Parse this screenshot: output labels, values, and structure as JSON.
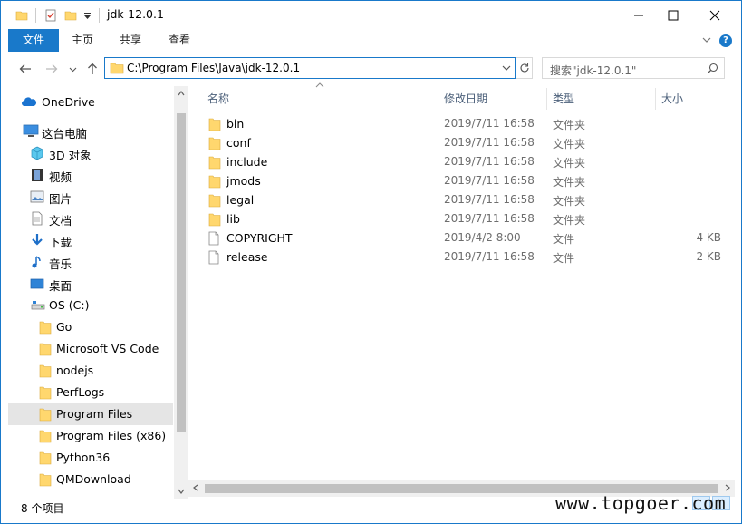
{
  "window": {
    "title": "jdk-12.0.1",
    "minimize": "─",
    "maximize": "☐",
    "close": "✕"
  },
  "ribbon": {
    "tabs": [
      "文件",
      "主页",
      "共享",
      "查看"
    ],
    "help": "?"
  },
  "address": {
    "path": "C:\\Program Files\\Java\\jdk-12.0.1",
    "search_placeholder": "搜索\"jdk-12.0.1\""
  },
  "nav": {
    "items": [
      {
        "label": "OneDrive",
        "icon": "cloud-icon"
      },
      {
        "label": "这台电脑",
        "icon": "computer-icon"
      },
      {
        "label": "3D 对象",
        "icon": "cube-icon"
      },
      {
        "label": "视频",
        "icon": "film-icon"
      },
      {
        "label": "图片",
        "icon": "picture-icon"
      },
      {
        "label": "文档",
        "icon": "document-icon"
      },
      {
        "label": "下载",
        "icon": "download-icon"
      },
      {
        "label": "音乐",
        "icon": "music-icon"
      },
      {
        "label": "桌面",
        "icon": "desktop-icon"
      },
      {
        "label": "OS (C:)",
        "icon": "drive-icon"
      },
      {
        "label": "Go",
        "icon": "folder-icon"
      },
      {
        "label": "Microsoft VS Code",
        "icon": "folder-icon"
      },
      {
        "label": "nodejs",
        "icon": "folder-icon"
      },
      {
        "label": "PerfLogs",
        "icon": "folder-icon"
      },
      {
        "label": "Program Files",
        "icon": "folder-icon",
        "selected": true
      },
      {
        "label": "Program Files (x86)",
        "icon": "folder-icon"
      },
      {
        "label": "Python36",
        "icon": "folder-icon"
      },
      {
        "label": "QMDownload",
        "icon": "folder-icon"
      }
    ]
  },
  "columns": {
    "name": "名称",
    "modified": "修改日期",
    "type": "类型",
    "size": "大小"
  },
  "files": [
    {
      "name": "bin",
      "date": "2019/7/11 16:58",
      "type": "文件夹",
      "size": "",
      "icon": "folder-icon"
    },
    {
      "name": "conf",
      "date": "2019/7/11 16:58",
      "type": "文件夹",
      "size": "",
      "icon": "folder-icon"
    },
    {
      "name": "include",
      "date": "2019/7/11 16:58",
      "type": "文件夹",
      "size": "",
      "icon": "folder-icon"
    },
    {
      "name": "jmods",
      "date": "2019/7/11 16:58",
      "type": "文件夹",
      "size": "",
      "icon": "folder-icon"
    },
    {
      "name": "legal",
      "date": "2019/7/11 16:58",
      "type": "文件夹",
      "size": "",
      "icon": "folder-icon"
    },
    {
      "name": "lib",
      "date": "2019/7/11 16:58",
      "type": "文件夹",
      "size": "",
      "icon": "folder-icon"
    },
    {
      "name": "COPYRIGHT",
      "date": "2019/4/2 8:00",
      "type": "文件",
      "size": "4 KB",
      "icon": "file-icon"
    },
    {
      "name": "release",
      "date": "2019/7/11 16:58",
      "type": "文件",
      "size": "2 KB",
      "icon": "file-icon"
    }
  ],
  "status": {
    "count": "8 个项目"
  },
  "watermark": "www.topgoer.com",
  "colors": {
    "accent": "#1979ca",
    "folder": "#ffd76e",
    "selected": "#e5e5e5"
  }
}
